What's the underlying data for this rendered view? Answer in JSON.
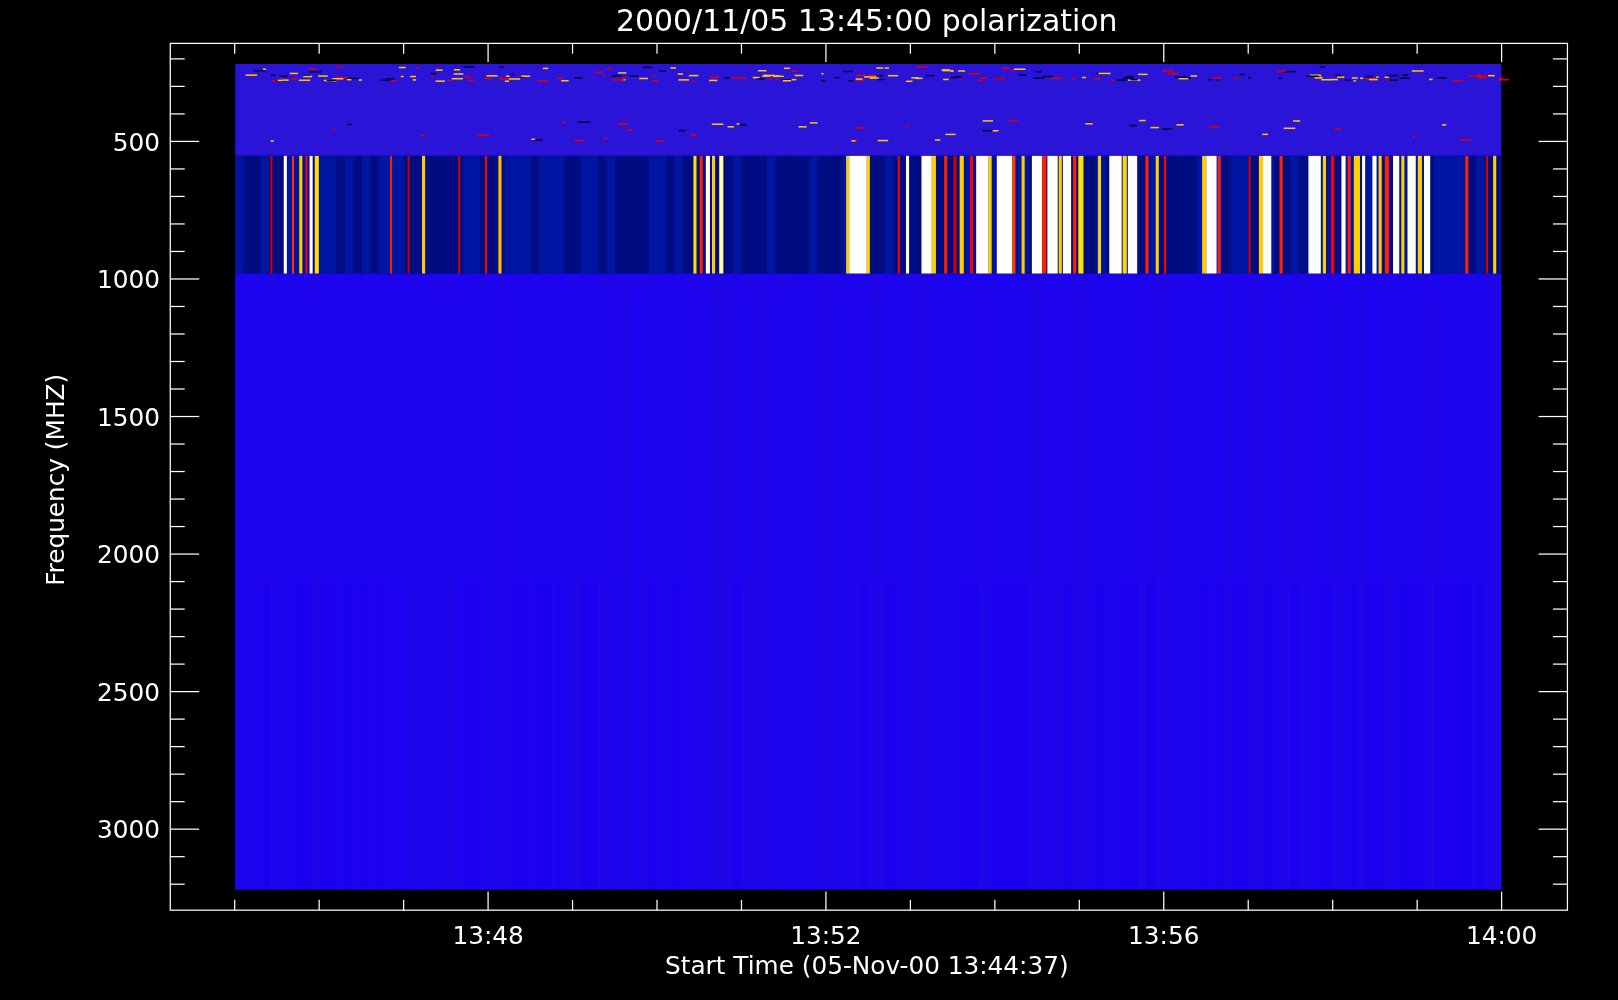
{
  "title": "2000/11/05 13:45:00 polarization",
  "y_axis": {
    "label": "Frequency (MHZ)",
    "ticks": [
      "500",
      "1000",
      "1500",
      "2000",
      "2500",
      "3000"
    ]
  },
  "x_axis": {
    "label": "Start Time (05-Nov-00 13:44:37)",
    "ticks": [
      "13:48",
      "13:52",
      "13:56",
      "14:00"
    ]
  }
}
